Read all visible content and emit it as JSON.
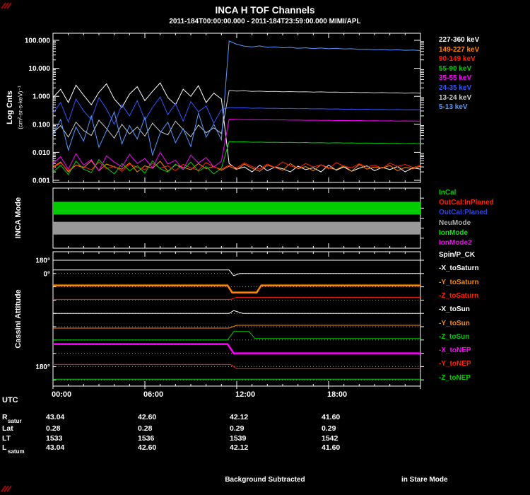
{
  "title": "INCA H TOF Channels",
  "subtitle": "2011-184T00:00:00.000 - 2011-184T23:59:00.000 MIMI/APL",
  "footer": {
    "center": "Background Subtracted",
    "right": "in Stare Mode"
  },
  "colors": {
    "background": "#000000",
    "frame": "#ffffff"
  },
  "axis": {
    "utc_label": "UTC",
    "x_tick_labels": [
      "00:00",
      "06:00",
      "12:00",
      "18:00"
    ],
    "x_tick_hours": [
      0,
      6,
      12,
      18
    ],
    "x_range_hours": [
      0,
      24
    ]
  },
  "ephemeris": {
    "rows": [
      {
        "label": "R",
        "sub": "satur",
        "values": [
          "43.04",
          "42.60",
          "42.12",
          "41.60"
        ]
      },
      {
        "label": "Lat",
        "sub": "",
        "values": [
          "0.28",
          "0.28",
          "0.29",
          "0.29"
        ]
      },
      {
        "label": "LT",
        "sub": "",
        "values": [
          "1533",
          "1536",
          "1539",
          "1542"
        ]
      },
      {
        "label": "L",
        "sub": "satum",
        "values": [
          "43.04",
          "42.60",
          "42.12",
          "41.60"
        ]
      }
    ]
  },
  "chart_data": [
    {
      "type": "line",
      "panel": "tof",
      "ylabel": "Log Cnts",
      "ylabel_units": "(cm²-sr-s-keV)⁻¹",
      "yscale": "log",
      "ylim": [
        0.001,
        100
      ],
      "ytick_labels": [
        "100.000",
        "10.000",
        "1.000",
        "0.100",
        "0.010",
        "0.001"
      ],
      "x_start_hours": 0,
      "x_step_hours": 0.5,
      "series": [
        {
          "name": "227-360 keV",
          "color": "#ffffff",
          "values": [
            0.9,
            1.8,
            0.6,
            2.5,
            1.1,
            0.5,
            1.4,
            2.8,
            0.8,
            0.4,
            1.2,
            2.2,
            0.7,
            1.5,
            3.0,
            0.9,
            0.5,
            1.8,
            1.0,
            2.4,
            0.6,
            1.3,
            0.8,
            0.004,
            0.0025,
            0.003,
            0.002,
            0.0035,
            0.0022,
            0.003,
            0.0026,
            0.002,
            0.0032,
            0.0024,
            0.0028,
            0.002,
            0.0035,
            0.0023,
            0.003,
            0.0021,
            0.0027,
            0.0033,
            0.0022,
            0.0029,
            0.0024,
            0.0031,
            0.002,
            0.0028,
            0.0025
          ]
        },
        {
          "name": "149-227 keV",
          "color": "#ff8800",
          "values": [
            0.003,
            0.0045,
            0.002,
            0.0035,
            0.0028,
            0.005,
            0.0022,
            0.0038,
            0.003,
            0.0025,
            0.0042,
            0.002,
            0.0033,
            0.0027,
            0.0048,
            0.0021,
            0.0036,
            0.0029,
            0.0024,
            0.004,
            0.0026,
            0.0031,
            0.0023,
            0.0032,
            0.0024,
            0.0038,
            0.0027,
            0.0021,
            0.0035,
            0.0029,
            0.0023,
            0.004,
            0.0026,
            0.0031,
            0.0022,
            0.0036,
            0.0028,
            0.0024,
            0.0033,
            0.0021,
            0.0037,
            0.0025,
            0.003,
            0.0027,
            0.0034,
            0.0022,
            0.0029,
            0.0026,
            0.0032
          ]
        },
        {
          "name": "90-149 keV",
          "color": "#ff2200",
          "values": [
            0.0028,
            0.0042,
            0.0022,
            0.0036,
            0.003,
            0.0024,
            0.0045,
            0.0026,
            0.0032,
            0.0021,
            0.0038,
            0.0029,
            0.0024,
            0.0041,
            0.0027,
            0.0033,
            0.0022,
            0.0037,
            0.0028,
            0.0023,
            0.0043,
            0.003,
            0.0025,
            0.0035,
            0.0028,
            0.0042,
            0.0031,
            0.0025,
            0.0038,
            0.0029,
            0.0045,
            0.0033,
            0.0027,
            0.004,
            0.003,
            0.0036,
            0.0026,
            0.0043,
            0.0032,
            0.0028,
            0.0039,
            0.003,
            0.0035,
            0.0027,
            0.0041,
            0.0031,
            0.0037,
            0.0029,
            0.0034
          ]
        },
        {
          "name": "55-90 keV",
          "color": "#00cc00",
          "values": [
            0.002,
            0.0035,
            0.0016,
            0.0048,
            0.0025,
            0.0019,
            0.0055,
            0.0028,
            0.0017,
            0.004,
            0.0022,
            0.0033,
            0.0018,
            0.005,
            0.0026,
            0.002,
            0.0038,
            0.0024,
            0.0045,
            0.0021,
            0.0031,
            0.0017,
            0.0027,
            0.024,
            0.0235,
            0.0238,
            0.023,
            0.0233,
            0.0227,
            0.023,
            0.0224,
            0.0227,
            0.0221,
            0.0224,
            0.0218,
            0.0221,
            0.0216,
            0.0219,
            0.0214,
            0.0217,
            0.0212,
            0.0214,
            0.021,
            0.0212,
            0.0208,
            0.021,
            0.0206,
            0.0208,
            0.0205
          ]
        },
        {
          "name": "35-55 keV",
          "color": "#ff00ff",
          "values": [
            0.004,
            0.007,
            0.0025,
            0.009,
            0.0035,
            0.0055,
            0.0022,
            0.0075,
            0.0045,
            0.003,
            0.0085,
            0.004,
            0.006,
            0.0028,
            0.01,
            0.0038,
            0.0052,
            0.0024,
            0.008,
            0.0042,
            0.0065,
            0.003,
            0.0048,
            0.152,
            0.149,
            0.147,
            0.148,
            0.145,
            0.146,
            0.143,
            0.144,
            0.141,
            0.142,
            0.139,
            0.14,
            0.138,
            0.139,
            0.136,
            0.137,
            0.135,
            0.136,
            0.133,
            0.134,
            0.132,
            0.133,
            0.131,
            0.132,
            0.13,
            0.13
          ]
        },
        {
          "name": "24-35 keV",
          "color": "#3355ff",
          "values": [
            0.25,
            0.6,
            0.12,
            0.8,
            0.3,
            0.15,
            0.9,
            0.35,
            0.1,
            0.5,
            0.2,
            0.7,
            0.14,
            0.4,
            0.95,
            0.22,
            0.55,
            0.13,
            0.65,
            0.28,
            0.45,
            0.11,
            0.33,
            0.4,
            0.385,
            0.39,
            0.375,
            0.38,
            0.37,
            0.375,
            0.365,
            0.37,
            0.36,
            0.365,
            0.355,
            0.36,
            0.35,
            0.355,
            0.345,
            0.35,
            0.342,
            0.346,
            0.338,
            0.342,
            0.334,
            0.338,
            0.33,
            0.334,
            0.33
          ]
        },
        {
          "name": "13-24 keV",
          "color": "#cccccc",
          "values": [
            0.05,
            0.09,
            0.035,
            0.12,
            0.06,
            0.04,
            0.14,
            0.07,
            0.032,
            0.1,
            0.045,
            0.08,
            0.038,
            0.11,
            0.055,
            0.042,
            0.13,
            0.065,
            0.036,
            0.095,
            0.05,
            0.075,
            0.047,
            1.6,
            1.55,
            1.57,
            1.5,
            1.53,
            1.48,
            1.5,
            1.46,
            1.48,
            1.44,
            1.46,
            1.42,
            1.44,
            1.4,
            1.42,
            1.38,
            1.4,
            1.36,
            1.38,
            1.34,
            1.36,
            1.32,
            1.34,
            1.3,
            1.32,
            1.3
          ]
        },
        {
          "name": "5-13 keV",
          "color": "#5599ff",
          "values": [
            0.04,
            0.15,
            0.012,
            0.08,
            0.025,
            0.2,
            0.015,
            0.06,
            0.28,
            0.02,
            0.09,
            0.03,
            0.18,
            0.008,
            0.05,
            0.12,
            0.022,
            0.07,
            0.016,
            0.25,
            0.035,
            0.1,
            0.028,
            95,
            72,
            62,
            58,
            63,
            56,
            58,
            54,
            56,
            52,
            54,
            51,
            53,
            50,
            52,
            49,
            50,
            47,
            48,
            46,
            47,
            45,
            46,
            44,
            45,
            43
          ]
        }
      ]
    },
    {
      "type": "mode-bars",
      "label": "INCA Mode",
      "legend": [
        {
          "label": "InCal",
          "color": "#00cc00"
        },
        {
          "label": "OutCal:InPlaned",
          "color": "#ff2200"
        },
        {
          "label": "OutCal:Planed",
          "color": "#3344dd"
        },
        {
          "label": "NeuMode",
          "color": "#aaaaaa"
        },
        {
          "label": "IonMode",
          "color": "#00ee00"
        },
        {
          "label": "IonMode2",
          "color": "#ff00ff"
        }
      ],
      "bars": [
        {
          "mode": "IonMode",
          "color": "#00cc00",
          "start_hour": 0,
          "end_hour": 24,
          "band": 2
        },
        {
          "mode": "NeuMode",
          "color": "#999999",
          "start_hour": 0,
          "end_hour": 24,
          "band": 4
        }
      ]
    },
    {
      "type": "line-rows",
      "label": "Cassini Attitude",
      "offset_unit": "deg",
      "rows": [
        {
          "name": "Spin/P_CK",
          "color": "#ffffff",
          "width": 1,
          "axis_label": "180°",
          "points": [
            [
              0,
              0
            ],
            [
              24,
              0
            ]
          ]
        },
        {
          "name": "-X_toSaturn",
          "color": "#ffffff",
          "width": 1,
          "axis_label": "0°",
          "points": [
            [
              0,
              10
            ],
            [
              11.5,
              10
            ],
            [
              11.8,
              -6
            ],
            [
              12.2,
              0
            ],
            [
              24,
              0
            ]
          ]
        },
        {
          "name": "-Y_toSaturn",
          "color": "#ff8800",
          "width": 2.5,
          "points": [
            [
              0,
              4
            ],
            [
              11.4,
              4
            ],
            [
              11.7,
              -16
            ],
            [
              13.3,
              -16
            ],
            [
              13.6,
              4
            ],
            [
              24,
              4
            ]
          ]
        },
        {
          "name": "-Z_toSaturn",
          "color": "#ff2200",
          "width": 1,
          "points": [
            [
              0,
              2
            ],
            [
              11.6,
              2
            ],
            [
              12,
              8
            ],
            [
              24,
              8
            ]
          ]
        },
        {
          "name": "-X_toSun",
          "color": "#ffffff",
          "width": 1,
          "points": [
            [
              0,
              0
            ],
            [
              11.5,
              0
            ],
            [
              11.8,
              8
            ],
            [
              12.4,
              0
            ],
            [
              24,
              0
            ]
          ]
        },
        {
          "name": "-Y_toSun",
          "color": "#ff8800",
          "width": 1,
          "points": [
            [
              0,
              -4
            ],
            [
              11.5,
              -4
            ],
            [
              12,
              4
            ],
            [
              24,
              4
            ]
          ]
        },
        {
          "name": "-Z_toSun",
          "color": "#00cc00",
          "width": 1,
          "points": [
            [
              0,
              0
            ],
            [
              11.4,
              0
            ],
            [
              11.8,
              24
            ],
            [
              12.8,
              24
            ],
            [
              13.2,
              4
            ],
            [
              24,
              4
            ]
          ]
        },
        {
          "name": "-X_toNEP",
          "color": "#ff00ff",
          "width": 2.5,
          "points": [
            [
              0,
              26
            ],
            [
              11.4,
              26
            ],
            [
              11.8,
              0
            ],
            [
              24,
              0
            ]
          ]
        },
        {
          "name": "-Y_toNEP",
          "color": "#ff2200",
          "width": 1,
          "axis_label": "180°",
          "points": [
            [
              0,
              6
            ],
            [
              11.6,
              6
            ],
            [
              12,
              -6
            ],
            [
              24,
              -6
            ]
          ]
        },
        {
          "name": "-Z_toNEP",
          "color": "#00cc00",
          "width": 1,
          "points": [
            [
              0,
              2
            ],
            [
              24,
              2
            ]
          ]
        }
      ]
    }
  ]
}
